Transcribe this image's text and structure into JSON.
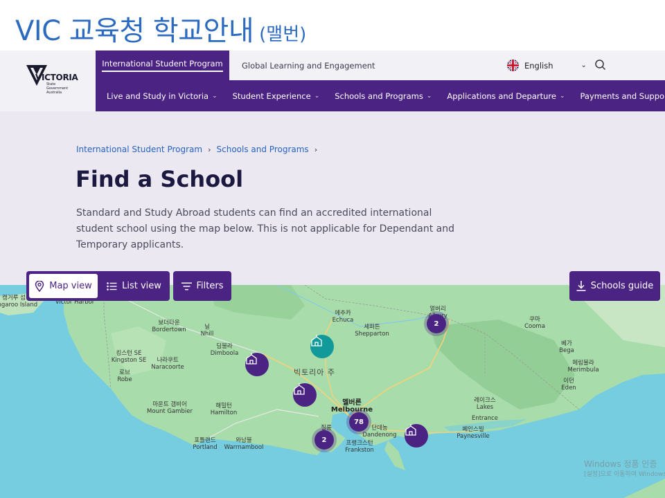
{
  "slide": {
    "title": "VIC 교육청 학교안내",
    "subtitle": "(맬번)"
  },
  "header": {
    "logo": {
      "wordmark": "VICTORIA",
      "line1": "State",
      "line2": "Government",
      "line3": "Australia"
    },
    "active_tab": "International Student Program",
    "tab2": "Global Learning and Engagement",
    "language": "English"
  },
  "nav": {
    "items": [
      {
        "label": "Live and Study in Victoria"
      },
      {
        "label": "Student Experience"
      },
      {
        "label": "Schools and Programs"
      },
      {
        "label": "Applications and Departure"
      },
      {
        "label": "Payments and Support"
      }
    ]
  },
  "breadcrumb": {
    "item1": "International Student Program",
    "item2": "Schools and Programs"
  },
  "main": {
    "title": "Find a School",
    "intro": "Standard and Study Abroad students can find an accredited international student school using the map below. This is not applicable for Dependant and Temporary applicants."
  },
  "toolbar": {
    "map_view": "Map view",
    "list_view": "List view",
    "filters": "Filters",
    "schools_guide": "Schools guide"
  },
  "map": {
    "places": [
      {
        "ko": "캥거루 섬",
        "en": "Kangaroo Island"
      },
      {
        "ko": "",
        "en": "Victor Harbor"
      },
      {
        "ko": "보더타운",
        "en": "Bordertown"
      },
      {
        "ko": "닐",
        "en": "Nhill"
      },
      {
        "ko": "딤불라",
        "en": "Dimboola"
      },
      {
        "ko": "킹스턴 SE",
        "en": "Kingston SE"
      },
      {
        "ko": "나라쿠트",
        "en": "Naracoorte"
      },
      {
        "ko": "로브",
        "en": "Robe"
      },
      {
        "ko": "마운트 갬비어",
        "en": "Mount Gambier"
      },
      {
        "ko": "해밀턴",
        "en": "Hamilton"
      },
      {
        "ko": "포틀랜드",
        "en": "Portland"
      },
      {
        "ko": "와남불",
        "en": "Warrnambool"
      },
      {
        "ko": "에추카",
        "en": "Echuca"
      },
      {
        "ko": "셰퍼튼",
        "en": "Shepparton"
      },
      {
        "ko": "질롱",
        "en": "Geelong"
      },
      {
        "ko": "단데농",
        "en": "Dandenong"
      },
      {
        "ko": "프랭크스턴",
        "en": "Frankston"
      },
      {
        "ko": "쿠마",
        "en": "Cooma"
      },
      {
        "ko": "베가",
        "en": "Bega"
      },
      {
        "ko": "메림불라",
        "en": "Merimbula"
      },
      {
        "ko": "이던",
        "en": "Eden"
      },
      {
        "ko": "레이크스",
        "en": "Lakes"
      },
      {
        "ko": "엔트런스",
        "en": "Entrance"
      },
      {
        "ko": "페인스빌",
        "en": "Paynesville"
      },
      {
        "ko": "얼버리",
        "en": "Albury"
      }
    ],
    "state_label": "빅토리아 주",
    "melbourne_ko": "멜버른",
    "melbourne_en": "Melbourne",
    "clusters": [
      {
        "count": "2"
      },
      {
        "count": "78"
      },
      {
        "count": "2"
      }
    ],
    "watermark_line1": "Windows 정품 인증",
    "watermark_line2": "[설정]으로 이동하여 Windows"
  },
  "colors": {
    "brand_purple": "#4b2383",
    "teal_pin": "#12999a",
    "link_blue": "#2463c2"
  }
}
